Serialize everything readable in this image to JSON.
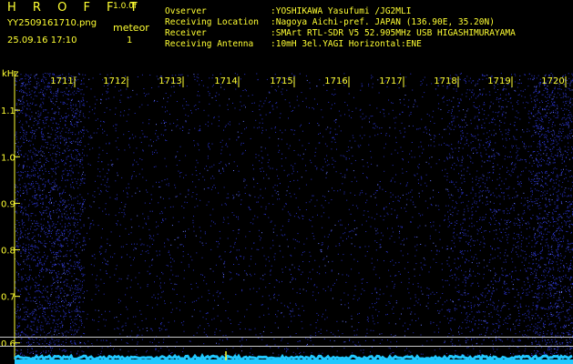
{
  "header": {
    "app_title": "H R O F F T",
    "version": "1.0.0f",
    "filename": "YY2509161710.png",
    "meteor_label": "meteor",
    "datetime": "25.09.16 17:10",
    "meteor_count": "1"
  },
  "info": [
    {
      "key": "Ovserver",
      "value": ":YOSHIKAWA Yasufumi /JG2MLI"
    },
    {
      "key": "Receiving Location",
      "value": ":Nagoya Aichi-pref. JAPAN (136.90E, 35.20N)"
    },
    {
      "key": "Receiver",
      "value": ":SMArt RTL-SDR V5 52.905MHz USB HIGASHIMURAYAMA"
    },
    {
      "key": "Receiving Antenna",
      "value": ":10mH 3el.YAGI Horizontal:ENE"
    }
  ],
  "colors": {
    "text": "#ffff33",
    "background": "#000000",
    "noise": "#2a32c8",
    "signal": "#20c8ff"
  },
  "chart_data": {
    "type": "heatmap",
    "ylabel": "kHz",
    "y_ticks": [
      {
        "value": 1.1,
        "label": "1.1"
      },
      {
        "value": 1.0,
        "label": "1.0"
      },
      {
        "value": 0.9,
        "label": "0.9"
      },
      {
        "value": 0.8,
        "label": "0.8"
      },
      {
        "value": 0.7,
        "label": "0.7"
      },
      {
        "value": 0.6,
        "label": "0.6"
      }
    ],
    "ylim": [
      0.58,
      1.2
    ],
    "x_ticks": [
      "1711",
      "1712",
      "1713",
      "1714",
      "1715",
      "1716",
      "1717",
      "1718",
      "1719",
      "1720"
    ],
    "xlim": [
      0,
      10
    ]
  }
}
